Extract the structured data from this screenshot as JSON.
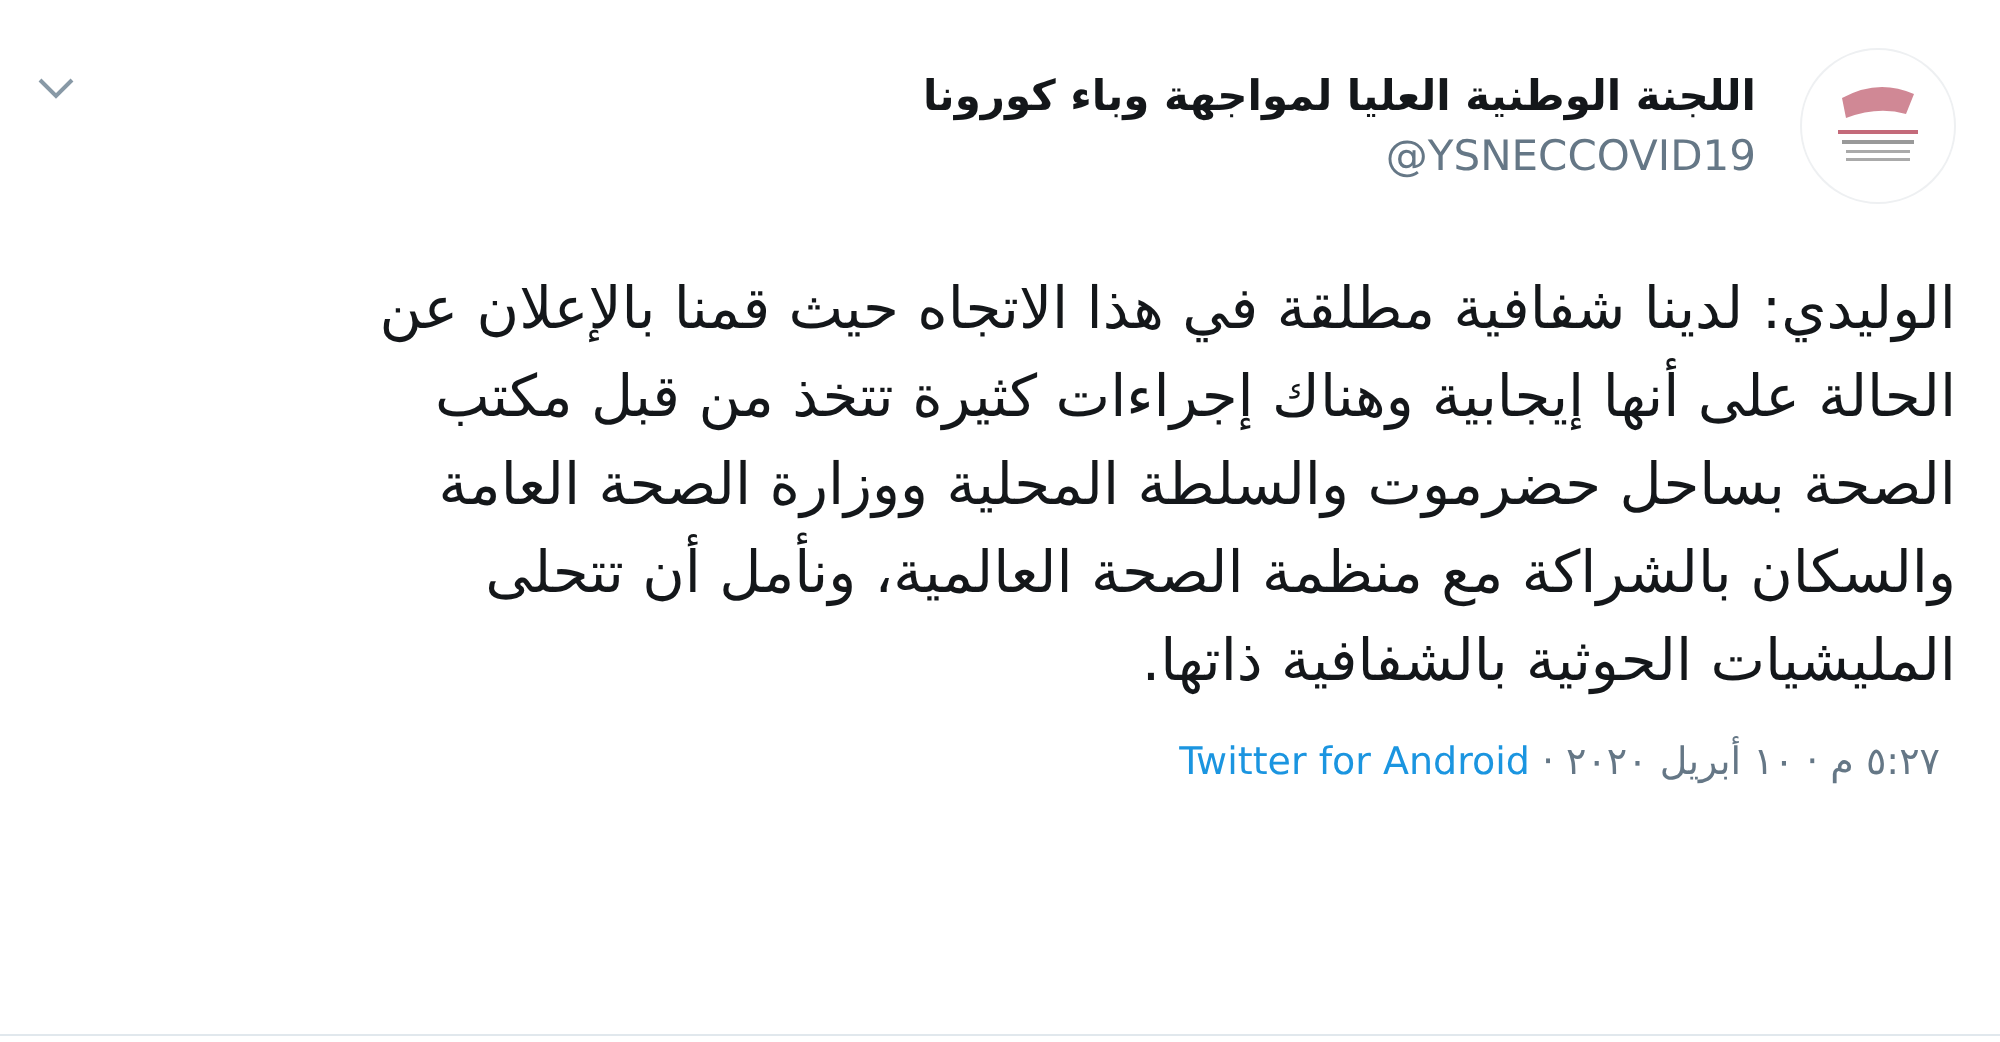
{
  "tweet": {
    "author_name": "اللجنة الوطنية العليا لمواجهة وباء كورونا",
    "handle": "@YSNECCOVID19",
    "text": "الوليدي: لدينا شفافية مطلقة في هذا الاتجاه حيث قمنا بالإعلان عن الحالة على أنها إيجابية وهناك إجراءات كثيرة تتخذ من قبل مكتب الصحة بساحل حضرموت والسلطة المحلية ووزارة الصحة العامة والسكان بالشراكة مع منظمة الصحة العالمية، ونأمل أن تتحلى المليشيات الحوثية بالشفافية ذاتها.",
    "timestamp": "٥:٢٧ م · ١٠ أبريل ٢٠٢٠",
    "separator": "·",
    "source": "Twitter for Android"
  }
}
